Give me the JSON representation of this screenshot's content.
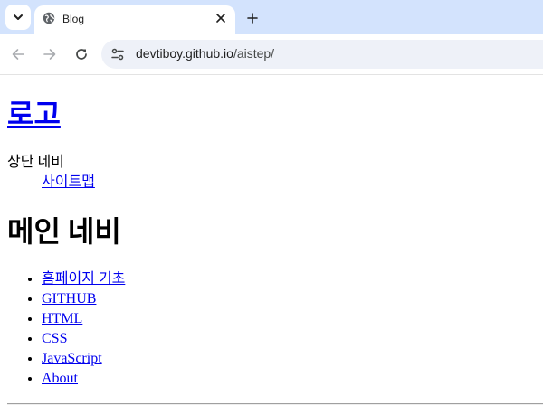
{
  "browser": {
    "tab_title": "Blog",
    "url_host": "devtiboy.github.io",
    "url_path": "/aistep/",
    "icons": {
      "tab_search": "chevron-down-icon",
      "favicon": "globe-icon",
      "close": "close-icon",
      "new_tab": "plus-icon",
      "back": "arrow-left-icon",
      "forward": "arrow-right-icon",
      "reload": "reload-icon",
      "site_info": "tune-icon"
    }
  },
  "page": {
    "logo": "로고",
    "top_nav_label": "상단 네비",
    "sitemap_link": "사이트맵",
    "main_nav_title": "메인 네비",
    "main_nav_items": [
      "홈페이지 기초",
      "GITHUB",
      "HTML",
      "CSS",
      "JavaScript",
      "About"
    ],
    "link_color": "#0000ee"
  }
}
